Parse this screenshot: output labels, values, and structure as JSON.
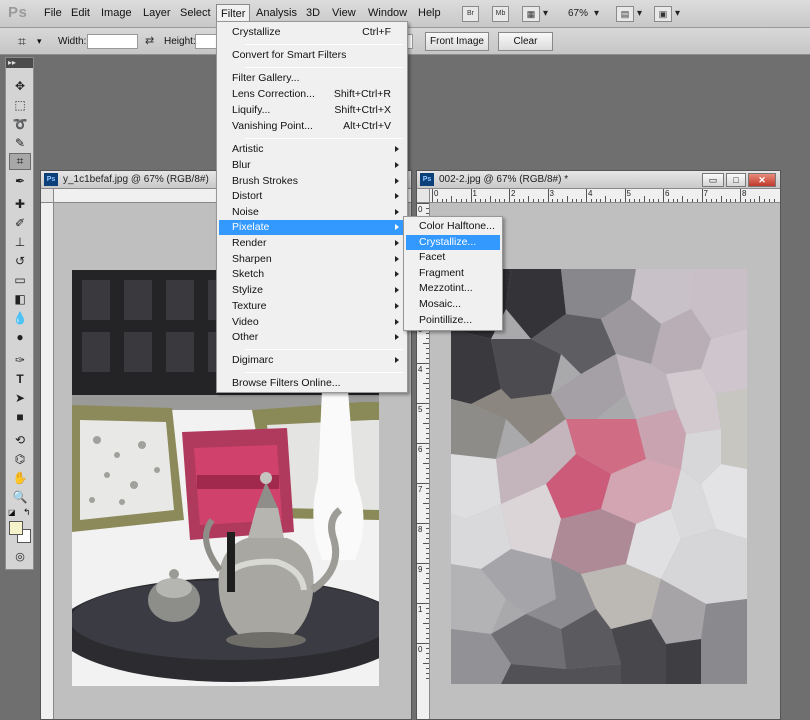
{
  "app": {
    "logo": "Ps"
  },
  "menubar": {
    "items": [
      "File",
      "Edit",
      "Image",
      "Layer",
      "Select",
      "Filter",
      "Analysis",
      "3D",
      "View",
      "Window",
      "Help"
    ],
    "active": "Filter",
    "bridge_label": "Br",
    "minibridge_label": "Mb",
    "zoom": "67%"
  },
  "options": {
    "width_label": "Width:",
    "height_label": "Height:",
    "width_value": "",
    "height_value": "",
    "front_image_label": "Front Image",
    "clear_label": "Clear"
  },
  "tools": {
    "header": "▸▸",
    "icons": [
      "move-tool-icon",
      "marquee-tool-icon",
      "lasso-tool-icon",
      "quick-selection-icon",
      "crop-tool-icon",
      "eyedropper-icon",
      "healing-brush-icon",
      "brush-tool-icon",
      "clone-stamp-icon",
      "history-brush-icon",
      "eraser-icon",
      "gradient-tool-icon",
      "blur-tool-icon",
      "dodge-tool-icon",
      "pen-tool-icon",
      "type-tool-icon",
      "path-selection-icon",
      "shape-tool-icon",
      "3d-rotate-icon",
      "3d-camera-icon",
      "hand-tool-icon",
      "zoom-tool-icon"
    ],
    "foreground_color": "#f5f2cc",
    "background_color": "#ffffff"
  },
  "documents": [
    {
      "title": "y_1c1befaf.jpg @ 67% (RGB/8#)",
      "badge": "Ps"
    },
    {
      "title": "002-2.jpg @ 67% (RGB/8#) *",
      "badge": "Ps"
    }
  ],
  "ruler": {
    "h_labels": [
      "0",
      "1",
      "2",
      "3",
      "4",
      "5",
      "6",
      "7",
      "8",
      "9"
    ],
    "v_labels": [
      "0",
      "1",
      "2",
      "3",
      "4",
      "5",
      "6",
      "7",
      "8",
      "9",
      "1",
      "0"
    ]
  },
  "filter_menu": {
    "top": [
      {
        "label": "Crystallize",
        "shortcut": "Ctrl+F"
      }
    ],
    "smart": [
      {
        "label": "Convert for Smart Filters"
      }
    ],
    "gallery": [
      {
        "label": "Filter Gallery..."
      },
      {
        "label": "Lens Correction...",
        "shortcut": "Shift+Ctrl+R"
      },
      {
        "label": "Liquify...",
        "shortcut": "Shift+Ctrl+X"
      },
      {
        "label": "Vanishing Point...",
        "shortcut": "Alt+Ctrl+V"
      }
    ],
    "categories": [
      "Artistic",
      "Blur",
      "Brush Strokes",
      "Distort",
      "Noise",
      "Pixelate",
      "Render",
      "Sharpen",
      "Sketch",
      "Stylize",
      "Texture",
      "Video",
      "Other"
    ],
    "highlighted": "Pixelate",
    "digimarc": "Digimarc",
    "browse": "Browse Filters Online..."
  },
  "pixelate_menu": {
    "items": [
      "Color Halftone...",
      "Crystallize...",
      "Facet",
      "Fragment",
      "Mezzotint...",
      "Mosaic...",
      "Pointillize..."
    ],
    "highlighted": "Crystallize..."
  }
}
